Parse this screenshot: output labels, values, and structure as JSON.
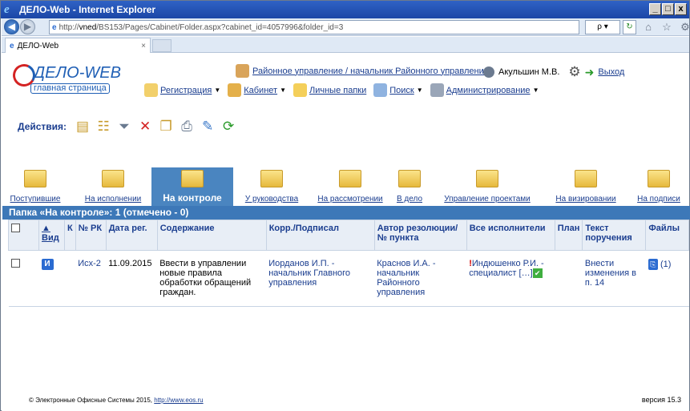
{
  "window": {
    "title": "ДЕЛО-Web - Internet Explorer",
    "min": "_",
    "max": "□",
    "close": "x"
  },
  "browser": {
    "url_prefix": "http://",
    "url_host": "vned",
    "url_rest": "/BS153/Pages/Cabinet/Folder.aspx?cabinet_id=4057996&folder_id=3",
    "search_symbol": "ρ ▾",
    "tab_title": "ДЕЛО-Web",
    "tab_close": "×"
  },
  "app": {
    "logo_title": "ДЕЛО-WEB",
    "logo_sub": "главная страница",
    "org_link": "Районное управление / начальник Районного управления",
    "user_name": "Акульшин М.В.",
    "logout": "Выход",
    "menu": [
      {
        "label": "Регистрация",
        "dropdown": true
      },
      {
        "label": "Кабинет",
        "dropdown": true
      },
      {
        "label": "Личные папки",
        "dropdown": false
      },
      {
        "label": "Поиск",
        "dropdown": true
      },
      {
        "label": "Администрирование",
        "dropdown": true
      }
    ],
    "actions_label": "Действия:",
    "folders": [
      {
        "label": "Поступившие",
        "active": false
      },
      {
        "label": "На исполнении",
        "active": false
      },
      {
        "label": "На контроле",
        "active": true
      },
      {
        "label": "У руководства",
        "active": false
      },
      {
        "label": "На рассмотрении",
        "active": false
      },
      {
        "label": "В дело",
        "active": false
      },
      {
        "label": "Управление проектами",
        "active": false
      },
      {
        "label": "На визировании",
        "active": false
      },
      {
        "label": "На подписи",
        "active": false
      }
    ],
    "folder_path": "Папка «На контроле»: 1 (отмечено - 0)",
    "columns": {
      "vid": "▲ Вид",
      "k": "К",
      "num": "№ РК",
      "date": "Дата рег.",
      "content": "Содержание",
      "corr": "Корр./Подписал",
      "author": "Автор резолюции/ № пункта",
      "executors": "Все исполнители",
      "plan": "План",
      "text": "Текст поручения",
      "files": "Файлы"
    },
    "rows": [
      {
        "vid": "И",
        "num": "Исх-2",
        "date": "11.09.2015",
        "content": "Ввести в управлении новые правила обработки обращений граждан.",
        "corr": "Иорданов И.П. - начальник Главного управления",
        "author": "Краснов И.А. - начальник Районного управления",
        "executors_mark": "!",
        "executors": "Индюшенко Р.И. - специалист […]",
        "text": "Внести изменения в п. 14",
        "files_count": "(1)"
      }
    ],
    "footer_text": "© Электронные Офисные Системы 2015,",
    "footer_link": "http://www.eos.ru",
    "version": "версия 15.3"
  },
  "colors": {
    "accent": "#3d78b8",
    "link": "#1a3d8f",
    "title": "#1b46a6"
  }
}
